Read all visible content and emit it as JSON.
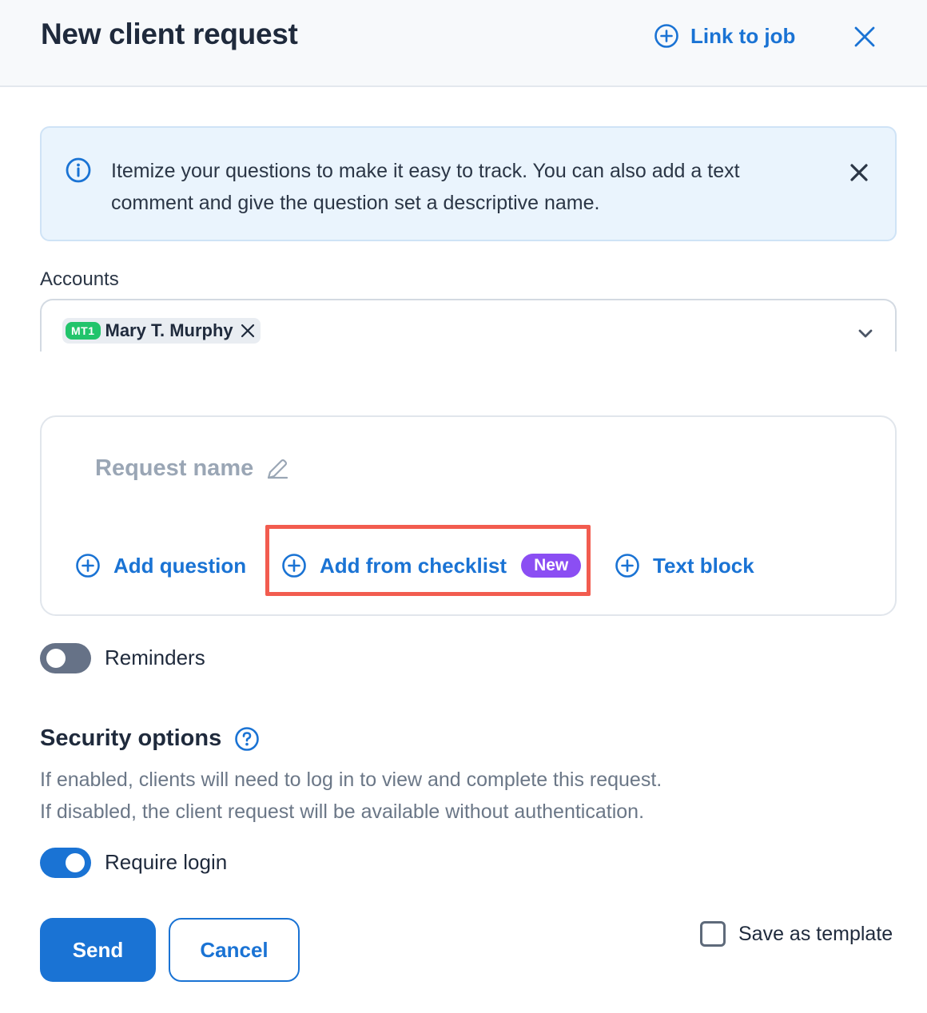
{
  "header": {
    "title": "New client request",
    "link_label": "Link to job"
  },
  "banner": {
    "text": "Itemize your questions to make it easy to track. You can also add a text comment and give the question set a descriptive name."
  },
  "accounts": {
    "label": "Accounts",
    "selected": [
      {
        "badge": "MT1",
        "name": "Mary T. Murphy"
      }
    ]
  },
  "request_card": {
    "name_placeholder": "Request name",
    "actions": {
      "add_question": "Add question",
      "add_from_checklist": "Add from checklist",
      "new_badge": "New",
      "text_block": "Text block"
    }
  },
  "reminders": {
    "label": "Reminders",
    "enabled": false
  },
  "security": {
    "title": "Security options",
    "desc_line1": "If enabled, clients will need to log in to view and complete this request.",
    "desc_line2": "If disabled, the client request will be available without authentication.",
    "require_login_label": "Require login",
    "require_login_enabled": true
  },
  "footer": {
    "send_label": "Send",
    "cancel_label": "Cancel",
    "save_template_label": "Save as template",
    "save_template_checked": false
  },
  "colors": {
    "accent": "#1a73d4",
    "new_badge": "#8b4ef3",
    "account_badge": "#22c46b",
    "highlight": "#f25c4f"
  }
}
